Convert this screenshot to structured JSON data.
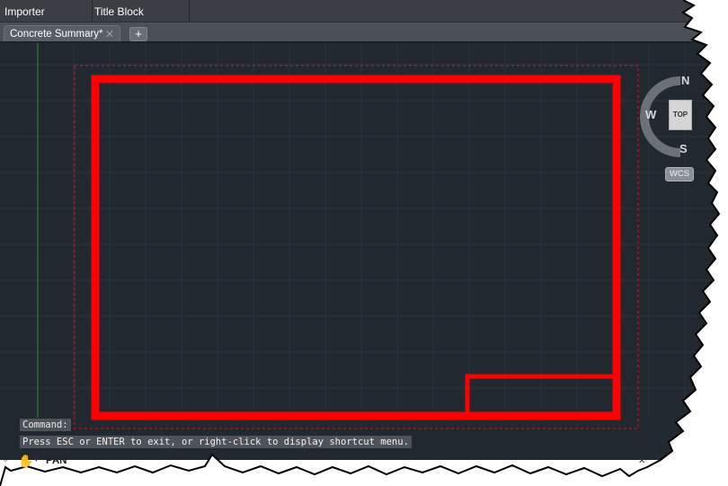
{
  "panel_tabs": [
    "Importer",
    "Title Block Manager"
  ],
  "document_tab": {
    "label": "Concrete Summary*",
    "close_glyph": "✕",
    "new_tab_glyph": "+"
  },
  "command_line": {
    "label": "Command:",
    "prompt": "Press ESC or ENTER to exit, or right-click to display shortcut menu."
  },
  "status": {
    "active_command": "PAN",
    "command_icon": "pan-hand-icon"
  },
  "viewcube": {
    "north": "N",
    "west": "W",
    "south": "S",
    "face": "TOP",
    "wcs_label": "WCS"
  },
  "colors": {
    "canvas_bg": "#212830",
    "grid_line": "#2c3440",
    "border_red": "#ff0000",
    "y_axis": "#2e8b3e"
  }
}
